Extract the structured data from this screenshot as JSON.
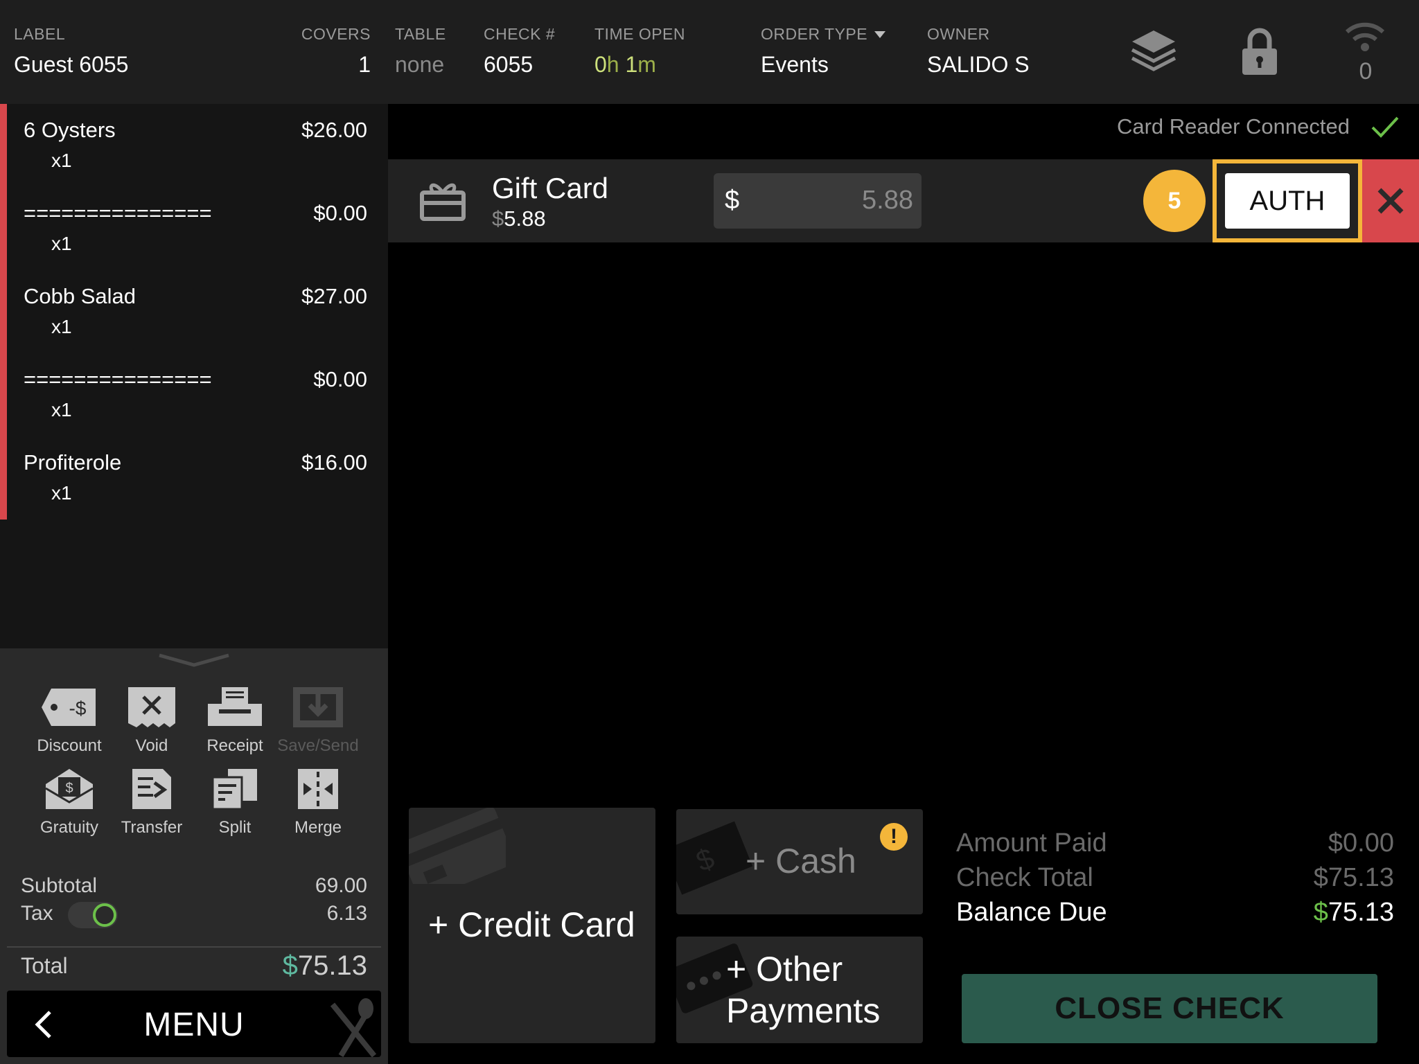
{
  "header": {
    "label": {
      "title": "LABEL",
      "value": "Guest 6055"
    },
    "covers": {
      "title": "COVERS",
      "value": "1"
    },
    "table": {
      "title": "TABLE",
      "value": "none"
    },
    "check": {
      "title": "CHECK #",
      "value": "6055"
    },
    "time_open": {
      "title": "TIME OPEN",
      "hours": "0",
      "h": "h",
      "minutes": "1",
      "m": "m"
    },
    "order_type": {
      "title": "ORDER TYPE",
      "value": "Events"
    },
    "owner": {
      "title": "OWNER",
      "value": "SALIDO S"
    },
    "wifi_count": "0"
  },
  "items": [
    {
      "name": "6 Oysters",
      "price": "$26.00",
      "qty": "x1"
    },
    {
      "name": "===============",
      "price": "$0.00",
      "qty": "x1"
    },
    {
      "name": "Cobb Salad",
      "price": "$27.00",
      "qty": "x1"
    },
    {
      "name": "===============",
      "price": "$0.00",
      "qty": "x1"
    },
    {
      "name": "Profiterole",
      "price": "$16.00",
      "qty": "x1"
    }
  ],
  "tools": {
    "discount": "Discount",
    "discount_glyph": "-$",
    "void": "Void",
    "receipt": "Receipt",
    "save_send": "Save/Send",
    "gratuity": "Gratuity",
    "transfer": "Transfer",
    "split": "Split",
    "merge": "Merge"
  },
  "summary": {
    "subtotal_label": "Subtotal",
    "subtotal": "69.00",
    "tax_label": "Tax",
    "tax": "6.13",
    "total_label": "Total",
    "total_symbol": "$",
    "total": "75.13"
  },
  "menu_label": "MENU",
  "card_reader": "Card Reader Connected",
  "gift_card": {
    "title": "Gift Card",
    "symbol": "$",
    "balance": "5.88",
    "amount": "5.88"
  },
  "step_badge": "5",
  "auth_label": "AUTH",
  "payments": {
    "credit": "+ Credit Card",
    "cash": "+ Cash",
    "other_line1": "+ Other",
    "other_line2": "Payments",
    "warning": "!",
    "cash_glyph": "$"
  },
  "totals": {
    "amount_paid_label": "Amount Paid",
    "amount_paid": "$0.00",
    "check_total_label": "Check Total",
    "check_total": "$75.13",
    "balance_due_label": "Balance Due",
    "balance_symbol": "$",
    "balance_due": "75.13"
  },
  "close_check": "CLOSE CHECK",
  "colors": {
    "accent_yellow": "#f4b63a",
    "danger_red": "#d8474c",
    "success_green": "#6cc04a",
    "close_green": "#2b5b4d"
  }
}
